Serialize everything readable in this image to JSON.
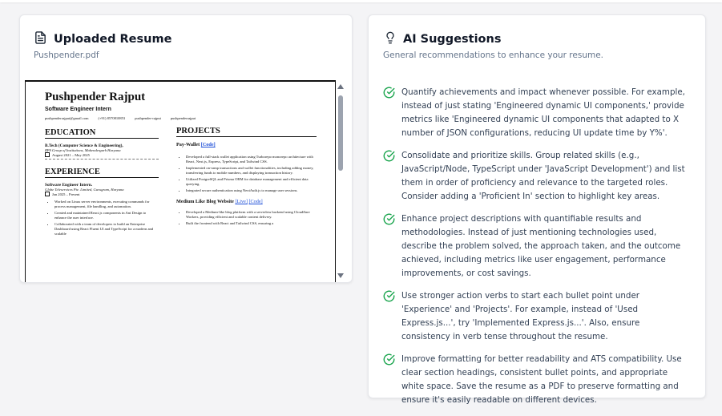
{
  "resume_card": {
    "title": "Uploaded Resume",
    "file_name": "Pushpender.pdf",
    "icon": "document-icon"
  },
  "resume": {
    "name": "Pushpender Rajput",
    "role": "Software Engineer Intern",
    "contacts": [
      "pushpenderrajput@gmail.com",
      "(+91) 8570810853",
      "pushpender-rajput",
      "pushpenderrajput"
    ],
    "education": {
      "heading": "EDUCATION",
      "degree": "B.Tech (Computer Science & Engineering),",
      "school": "RPS Group of Institutions, Mahendergarh Haryana",
      "dates": "August 2021 – May 2025"
    },
    "experience": {
      "heading": "EXPERIENCE",
      "title": "Software Engineer Intern.",
      "company": "Globe Teleservices Pte. Limited, Gurugram, Haryana",
      "dates": "Jan 2025 – Present",
      "bullets": [
        "Worked on Linux server environments, executing commands for process management, file handling, and automation.",
        "Created and maintained React.js components in Ant Design to enhance the user interface.",
        "Collaborated with a team of developers to build an Enterprise Dashboard using React Fluent UI and TypeScript for a modern and scalable"
      ]
    },
    "projects": {
      "heading": "PROJECTS",
      "p1_name": "Pay-Wallet",
      "p1_link": "[Code]",
      "p1_bullets": [
        "Developed a full-stack wallet application using Turborepo monorepo architecture with React, Next.js, Express, TypeScript, and Tailwind CSS.",
        "Implemented on-ramp transactions and wallet functionalities, including adding money, transferring funds to mobile numbers, and displaying transaction history.",
        "Utilized PostgreSQL and Prisma ORM for database management and efficient data querying.",
        "Integrated secure authentication using NextAuth.js to manage user sessions."
      ],
      "p2_name": "Medium Like Blog Website",
      "p2_link1": "[Live]",
      "p2_link2": "[Code]",
      "p2_bullets": [
        "Developed a Medium-like blog platform with a serverless backend using Cloudflare Workers, providing efficient and scalable content delivery.",
        "Built the frontend with React and Tailwind CSS, ensuring a"
      ]
    }
  },
  "ai_card": {
    "title": "AI Suggestions",
    "subtitle": "General recommendations to enhance your resume.",
    "icon": "lightbulb-icon"
  },
  "suggestions": [
    "Quantify achievements and impact whenever possible. For example, instead of just stating 'Engineered dynamic UI components,' provide metrics like 'Engineered dynamic UI components that adapted to X number of JSON configurations, reducing UI update time by Y%'.",
    "Consolidate and prioritize skills. Group related skills (e.g., JavaScript/Node, TypeScript under 'JavaScript Development') and list them in order of proficiency and relevance to the targeted roles. Consider adding a 'Proficient In' section to highlight key areas.",
    "Enhance project descriptions with quantifiable results and methodologies. Instead of just mentioning technologies used, describe the problem solved, the approach taken, and the outcome achieved, including metrics like user engagement, performance improvements, or cost savings.",
    "Use stronger action verbs to start each bullet point under 'Experience' and 'Projects'. For example, instead of 'Used Express.js...', try 'Implemented Express.js...'. Also, ensure consistency in verb tense throughout the resume.",
    "Improve formatting for better readability and ATS compatibility. Use clear section headings, consistent bullet points, and appropriate white space. Save the resume as a PDF to preserve formatting and ensure it's easily readable on different devices."
  ],
  "colors": {
    "accent_green": "#16a34a",
    "muted": "#64748b"
  }
}
